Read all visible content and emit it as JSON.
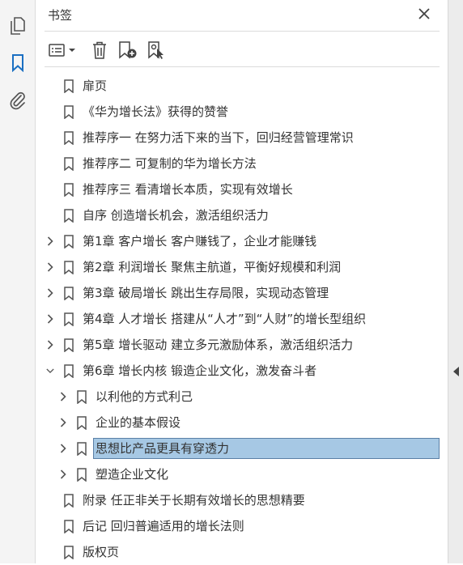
{
  "sidebar": {
    "items": [
      {
        "name": "pages-icon"
      },
      {
        "name": "bookmark-icon",
        "active": true
      },
      {
        "name": "paperclip-icon"
      }
    ]
  },
  "panel": {
    "title": "书签",
    "toolbar": [
      "options-menu-icon",
      "delete-icon",
      "new-bookmark-icon",
      "bookmark-from-selection-icon"
    ]
  },
  "accent": "#1a6fc2",
  "selection_color": "#a6c8e4",
  "bookmarks": [
    {
      "label": "扉页",
      "level": 0,
      "expander": "none"
    },
    {
      "label": "《华为增长法》获得的赞誉",
      "level": 0,
      "expander": "none"
    },
    {
      "label": "推荐序一 在努力活下来的当下，回归经营管理常识",
      "level": 0,
      "expander": "none"
    },
    {
      "label": "推荐序二 可复制的华为增长方法",
      "level": 0,
      "expander": "none"
    },
    {
      "label": "推荐序三 看清增长本质，实现有效增长",
      "level": 0,
      "expander": "none"
    },
    {
      "label": "自序 创造增长机会，激活组织活力",
      "level": 0,
      "expander": "none"
    },
    {
      "label": "第1章 客户增长 客户赚钱了，企业才能赚钱",
      "level": 0,
      "expander": "collapsed"
    },
    {
      "label": "第2章 利润增长 聚焦主航道，平衡好规模和利润",
      "level": 0,
      "expander": "collapsed"
    },
    {
      "label": "第3章 破局增长 跳出生存局限，实现动态管理",
      "level": 0,
      "expander": "collapsed"
    },
    {
      "label": "第4章 人才增长 搭建从“人才”到“人财”的增长型组织",
      "level": 0,
      "expander": "collapsed"
    },
    {
      "label": "第5章 增长驱动 建立多元激励体系，激活组织活力",
      "level": 0,
      "expander": "collapsed"
    },
    {
      "label": "第6章 增长内核 锻造企业文化，激发奋斗者",
      "level": 0,
      "expander": "expanded"
    },
    {
      "label": "以利他的方式利己",
      "level": 1,
      "expander": "collapsed"
    },
    {
      "label": "企业的基本假设",
      "level": 1,
      "expander": "collapsed"
    },
    {
      "label": "思想比产品更具有穿透力",
      "level": 1,
      "expander": "collapsed",
      "selected": true
    },
    {
      "label": "塑造企业文化",
      "level": 1,
      "expander": "collapsed"
    },
    {
      "label": "附录 任正非关于长期有效增长的思想精要",
      "level": 0,
      "expander": "none"
    },
    {
      "label": "后记 回归普遍适用的增长法则",
      "level": 0,
      "expander": "none"
    },
    {
      "label": "版权页",
      "level": 0,
      "expander": "none"
    }
  ]
}
